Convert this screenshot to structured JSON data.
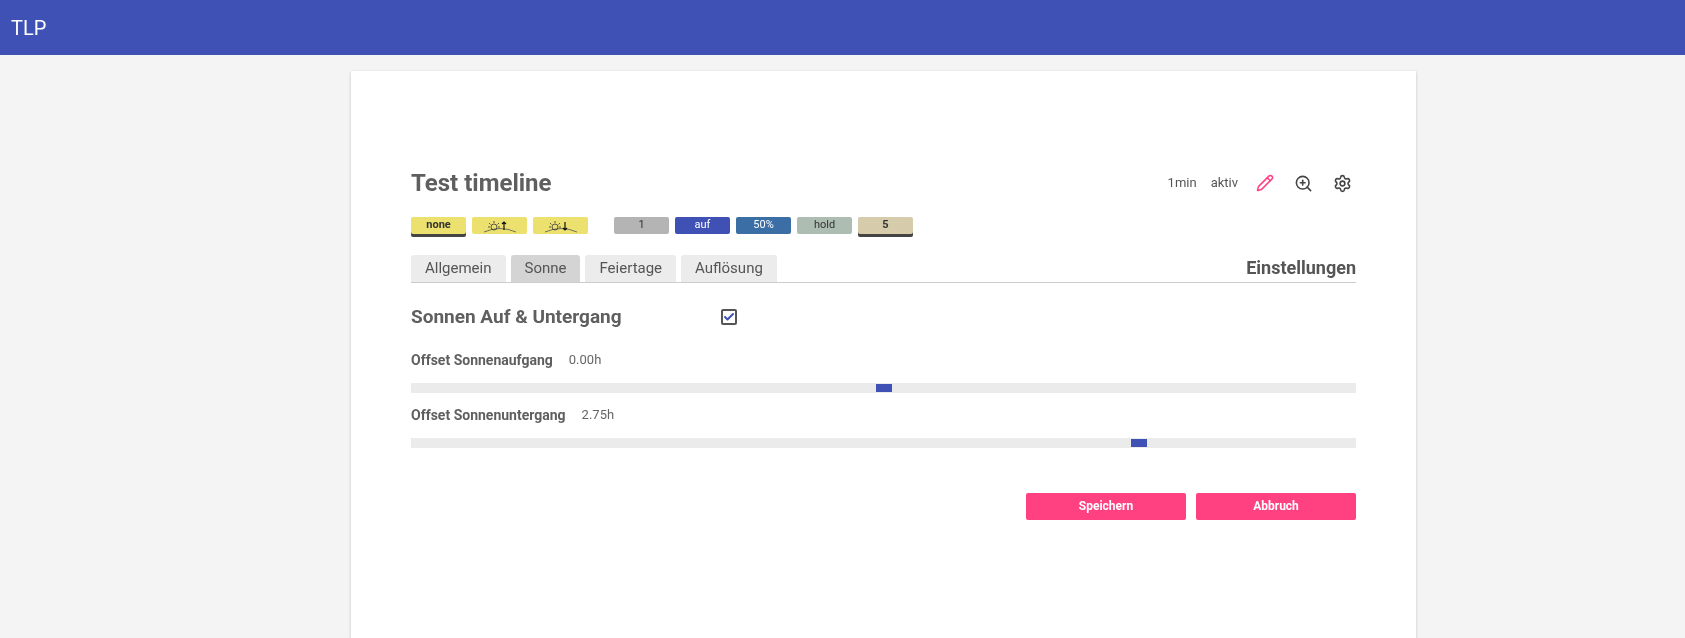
{
  "app_bar": {
    "title": "TLP"
  },
  "timeline": {
    "title": "Test timeline",
    "interval": "1min",
    "status": "aktiv"
  },
  "tags": [
    {
      "kind": "text",
      "label": "none",
      "color": "#ece06f",
      "selected": true
    },
    {
      "kind": "sunrise",
      "color": "#ece06f",
      "selected": false
    },
    {
      "kind": "sunset",
      "color": "#ece06f",
      "selected": false
    },
    {
      "kind": "text",
      "label": "1",
      "color": "#b4b4b4",
      "selected": false
    },
    {
      "kind": "text",
      "label": "auf",
      "color": "#3f51b5",
      "selected": false
    },
    {
      "kind": "text",
      "label": "50%",
      "color": "#3a6ea5",
      "selected": false
    },
    {
      "kind": "text",
      "label": "hold",
      "color": "#adbdb2",
      "selected": false
    },
    {
      "kind": "text",
      "label": "5",
      "color": "#d6cbaa",
      "selected": true
    }
  ],
  "tabs": [
    {
      "label": "Allgemein",
      "selected": false
    },
    {
      "label": "Sonne",
      "selected": true
    },
    {
      "label": "Feiertage",
      "selected": false
    },
    {
      "label": "Auflösung",
      "selected": false
    }
  ],
  "section_heading": "Einstellungen",
  "sun": {
    "title": "Sonnen Auf & Untergang",
    "checked": true
  },
  "sliders": [
    {
      "label": "Offset Sonnenaufgang",
      "reading": "0.00h",
      "level": 0.5
    },
    {
      "label": "Offset Sonnenuntergang",
      "reading": "2.75h",
      "level": 0.77
    }
  ],
  "buttons": [
    "Speichern",
    "Abbruch"
  ]
}
